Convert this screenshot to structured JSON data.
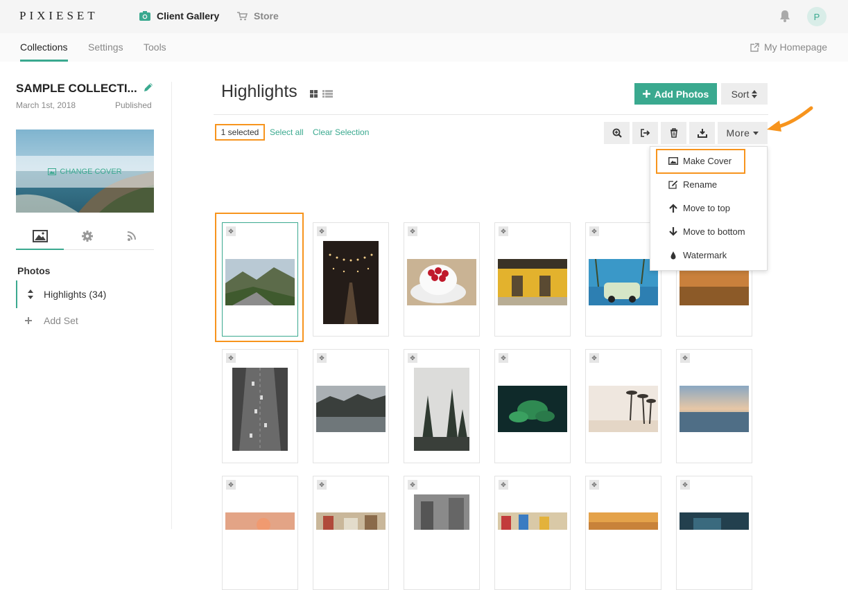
{
  "topbar": {
    "logo": "PIXIESET",
    "nav": [
      {
        "label": "Client Gallery",
        "icon": "camera-icon",
        "active": true
      },
      {
        "label": "Store",
        "icon": "cart-icon",
        "active": false
      }
    ],
    "avatar_initial": "P"
  },
  "subbar": {
    "tabs": [
      "Collections",
      "Settings",
      "Tools"
    ],
    "active_tab": "Collections",
    "my_homepage": "My Homepage"
  },
  "sidebar": {
    "collection_name": "SAMPLE COLLECTI...",
    "date": "March 1st, 2018",
    "status": "Published",
    "change_cover": "CHANGE COVER",
    "photos_heading": "Photos",
    "sets": [
      {
        "label": "Highlights (34)"
      }
    ],
    "add_set": "Add Set"
  },
  "main": {
    "title": "Highlights",
    "add_photos": "Add Photos",
    "sort": "Sort",
    "selected_count": "1 selected",
    "select_all": "Select all",
    "clear_selection": "Clear Selection",
    "more": "More",
    "more_menu": [
      {
        "label": "Make Cover",
        "icon": "image-icon"
      },
      {
        "label": "Rename",
        "icon": "edit-icon"
      },
      {
        "label": "Move to top",
        "icon": "arrow-up-icon"
      },
      {
        "label": "Move to bottom",
        "icon": "arrow-down-icon"
      },
      {
        "label": "Watermark",
        "icon": "drop-icon"
      }
    ]
  },
  "colors": {
    "accent": "#3aa98f",
    "highlight": "#f7941d"
  }
}
